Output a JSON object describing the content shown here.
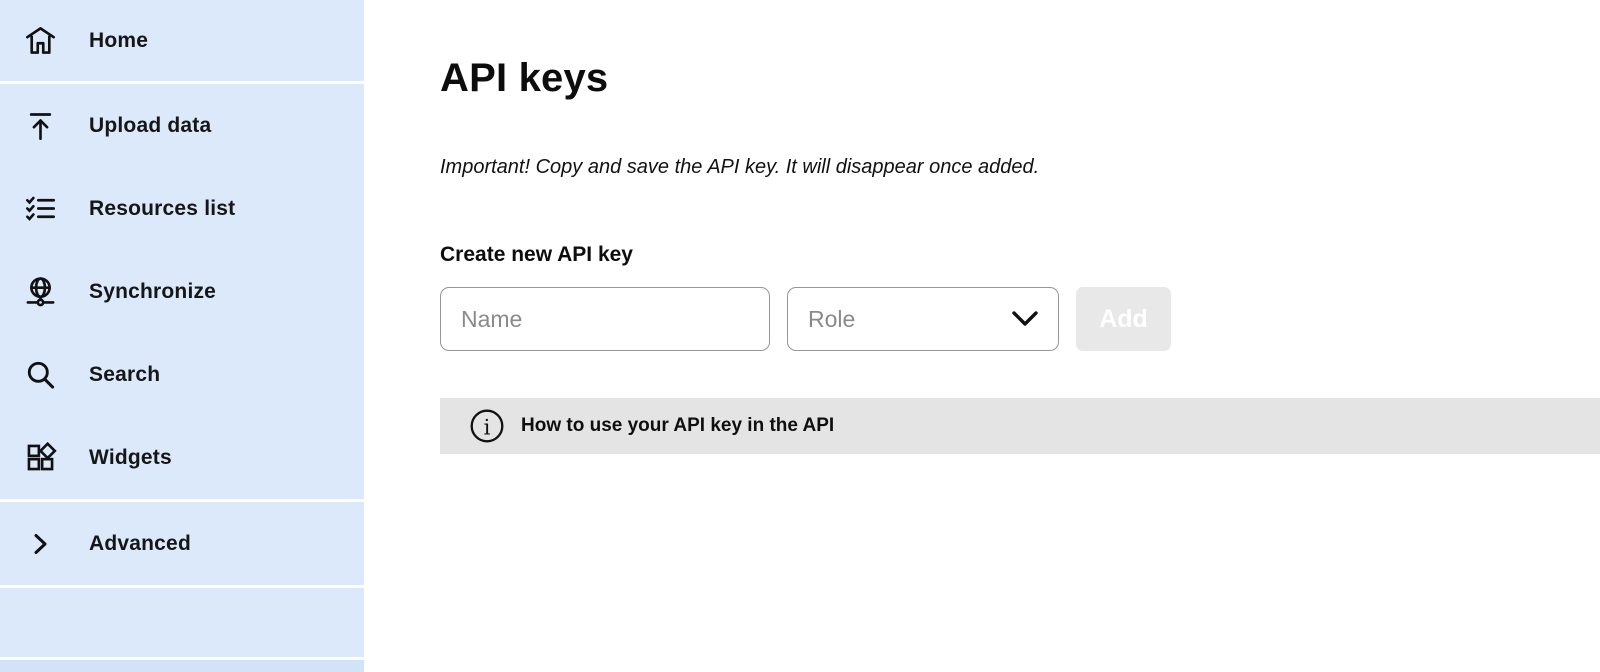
{
  "sidebar": {
    "items": [
      {
        "label": "Home",
        "icon": "home-icon"
      },
      {
        "label": "Upload data",
        "icon": "upload-icon"
      },
      {
        "label": "Resources list",
        "icon": "checklist-icon"
      },
      {
        "label": "Synchronize",
        "icon": "globe-network-icon"
      },
      {
        "label": "Search",
        "icon": "search-icon"
      },
      {
        "label": "Widgets",
        "icon": "widgets-icon"
      },
      {
        "label": "Advanced",
        "icon": "chevron-right-icon"
      }
    ]
  },
  "main": {
    "title": "API keys",
    "notice": "Important! Copy and save the API key. It will disappear once added.",
    "create": {
      "heading": "Create new API key",
      "name_placeholder": "Name",
      "role_placeholder": "Role",
      "add_label": "Add"
    },
    "info_banner": {
      "icon": "info-icon",
      "text": "How to use your API key in the API"
    }
  },
  "colors": {
    "sidebar_bg": "#dbe9fb",
    "sidebar_bottom_strip": "#d2e3f8",
    "divider": "#ffffff",
    "banner_bg": "#e4e4e4",
    "add_button_bg": "#e8e8e8",
    "add_button_text": "#ffffff",
    "input_border": "#969696",
    "placeholder_text": "#8a8a8a",
    "text": "#111111"
  }
}
